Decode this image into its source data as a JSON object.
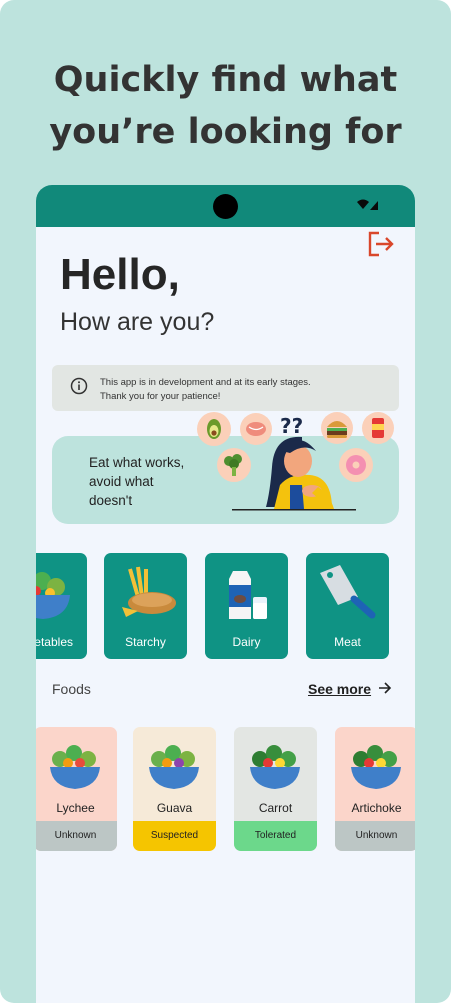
{
  "promo": {
    "line1": "Quickly find what",
    "line2": "you’re looking for"
  },
  "header": {
    "greeting": "Hello,",
    "subtitle": "How are you?"
  },
  "notice": {
    "line1": "This app is in development and at its early stages.",
    "line2": "Thank you for your patience!"
  },
  "banner": {
    "line1": "Eat what works,",
    "line2": "avoid what",
    "line3": "doesn't"
  },
  "categories": [
    {
      "label": "Vegetables"
    },
    {
      "label": "Starchy"
    },
    {
      "label": "Dairy"
    },
    {
      "label": "Meat"
    }
  ],
  "foods_section": {
    "title": "Foods",
    "see_more": "See more"
  },
  "foods": [
    {
      "name": "Lychee",
      "status": "Unknown"
    },
    {
      "name": "Guava",
      "status": "Suspected"
    },
    {
      "name": "Carrot",
      "status": "Tolerated"
    },
    {
      "name": "Artichoke",
      "status": "Unknown"
    }
  ],
  "colors": {
    "teal": "#11897a",
    "card_teal": "#0f9384",
    "logout_red": "#d9472b",
    "unknown": "#bcc6c5",
    "suspected": "#f5c500",
    "tolerated": "#6cd88b"
  }
}
